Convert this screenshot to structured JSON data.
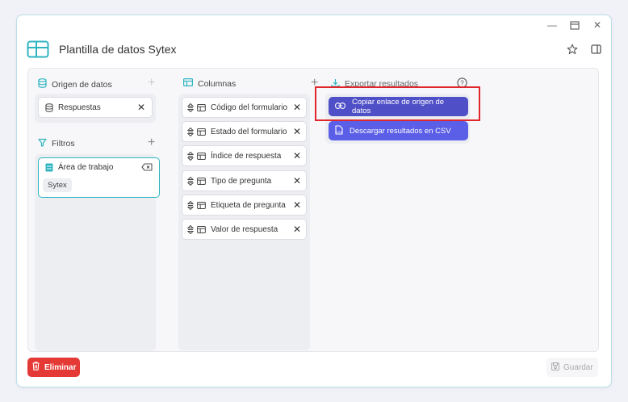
{
  "window": {
    "title": "Plantilla de datos Sytex"
  },
  "data_source": {
    "label": "Origen de datos",
    "items": [
      {
        "label": "Respuestas"
      }
    ]
  },
  "filters": {
    "label": "Filtros",
    "items": [
      {
        "label": "Área de trabajo",
        "value": "Sytex"
      }
    ]
  },
  "columns": {
    "label": "Columnas",
    "items": [
      {
        "label": "Código del formulario"
      },
      {
        "label": "Estado del formulario"
      },
      {
        "label": "Índice de respuesta"
      },
      {
        "label": "Tipo de pregunta"
      },
      {
        "label": "Etiqueta de pregunta"
      },
      {
        "label": "Valor de respuesta"
      }
    ]
  },
  "export": {
    "label": "Exportar resultados",
    "copy_link": "Copiar enlace de origen de datos",
    "download_csv": "Descargar resultados en CSV"
  },
  "footer": {
    "delete_label": "Eliminar",
    "save_label": "Guardar"
  },
  "colors": {
    "accent": "#5b5ee6",
    "danger": "#e53935",
    "teal": "#2fb5c2"
  }
}
